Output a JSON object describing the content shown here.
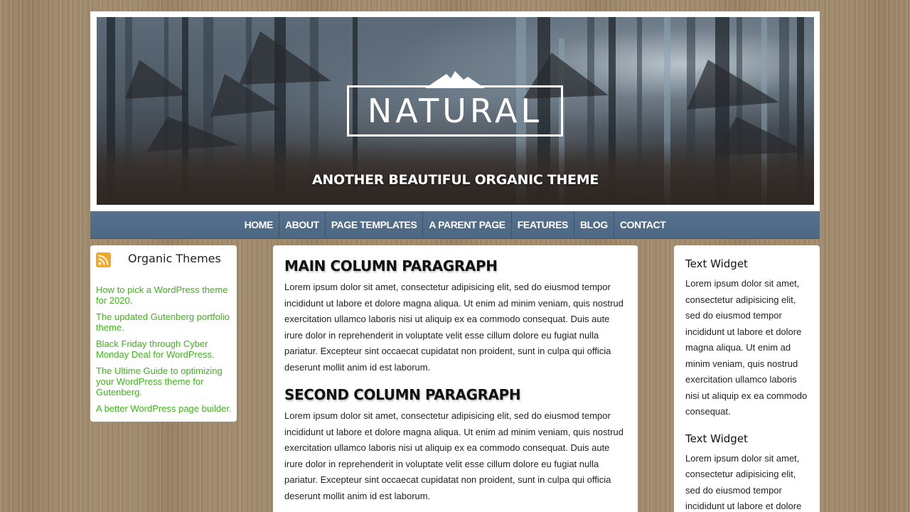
{
  "header": {
    "logo_text": "NATURAL",
    "tagline": "ANOTHER BEAUTIFUL ORGANIC THEME"
  },
  "nav": {
    "items": [
      {
        "label": "HOME"
      },
      {
        "label": "ABOUT"
      },
      {
        "label": "PAGE TEMPLATES"
      },
      {
        "label": "A PARENT PAGE"
      },
      {
        "label": "FEATURES"
      },
      {
        "label": "BLOG"
      },
      {
        "label": "CONTACT"
      }
    ]
  },
  "left_sidebar": {
    "icon": "rss-icon",
    "title": "Organic Themes",
    "links": [
      {
        "label": "How to pick a WordPress theme for 2020."
      },
      {
        "label": "The updated Gutenberg portfolio theme."
      },
      {
        "label": "Black Friday through Cyber Monday Deal for WordPress."
      },
      {
        "label": "The Ultime Guide to optimizing your WordPress theme for Gutenberg."
      },
      {
        "label": "A better WordPress page builder."
      }
    ],
    "link_color": "#3fb31b"
  },
  "main": {
    "sections": [
      {
        "heading": "MAIN COLUMN PARAGRAPH",
        "body": "Lorem ipsum dolor sit amet, consectetur adipisicing elit, sed do eiusmod tempor incididunt ut labore et dolore magna aliqua. Ut enim ad minim veniam, quis nostrud exercitation ullamco laboris nisi ut aliquip ex ea commodo consequat. Duis aute irure dolor in reprehenderit in voluptate velit esse cillum dolore eu fugiat nulla pariatur. Excepteur sint occaecat cupidatat non proident, sunt in culpa qui officia deserunt mollit anim id est laborum."
      },
      {
        "heading": "SECOND COLUMN PARAGRAPH",
        "body": "Lorem ipsum dolor sit amet, consectetur adipisicing elit, sed do eiusmod tempor incididunt ut labore et dolore magna aliqua. Ut enim ad minim veniam, quis nostrud exercitation ullamco laboris nisi ut aliquip ex ea commodo consequat. Duis aute irure dolor in reprehenderit in voluptate velit esse cillum dolore eu fugiat nulla pariatur. Excepteur sint occaecat cupidatat non proident, sunt in culpa qui officia deserunt mollit anim id est laborum."
      }
    ]
  },
  "right_sidebar": {
    "widgets": [
      {
        "title": "Text Widget",
        "body": "Lorem ipsum dolor sit amet, consectetur adipisicing elit, sed do eiusmod tempor incididunt ut labore et dolore magna aliqua. Ut enim ad minim veniam, quis nostrud exercitation ullamco laboris nisi ut aliquip ex ea commodo consequat."
      },
      {
        "title": "Text Widget",
        "body": "Lorem ipsum dolor sit amet, consectetur adipisicing elit, sed do eiusmod tempor incididunt ut labore et dolore"
      }
    ]
  },
  "colors": {
    "nav_bg": "#55708d",
    "background_wood": "#a08a6c",
    "rss_orange": "#f5a623"
  }
}
